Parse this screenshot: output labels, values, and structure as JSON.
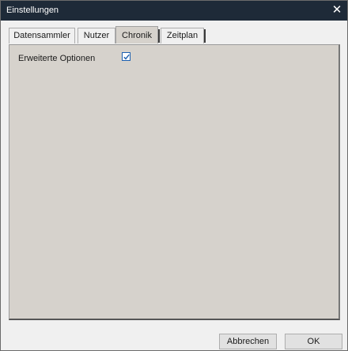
{
  "window": {
    "title": "Einstellungen",
    "close_glyph": "✕"
  },
  "tabs": [
    {
      "label": "Datensammler"
    },
    {
      "label": "Nutzer"
    },
    {
      "label": "Chronik"
    },
    {
      "label": "Zeitplan"
    }
  ],
  "active_tab": "Chronik",
  "options": {
    "advanced_label": "Erweiterte Optionen",
    "advanced_checked": true
  },
  "buttons": {
    "cancel": "Abbrechen",
    "ok": "OK"
  },
  "colors": {
    "titlebar": "#1e2a38",
    "panel": "#d6d2cc",
    "checkbox_accent": "#1b5fb0"
  }
}
